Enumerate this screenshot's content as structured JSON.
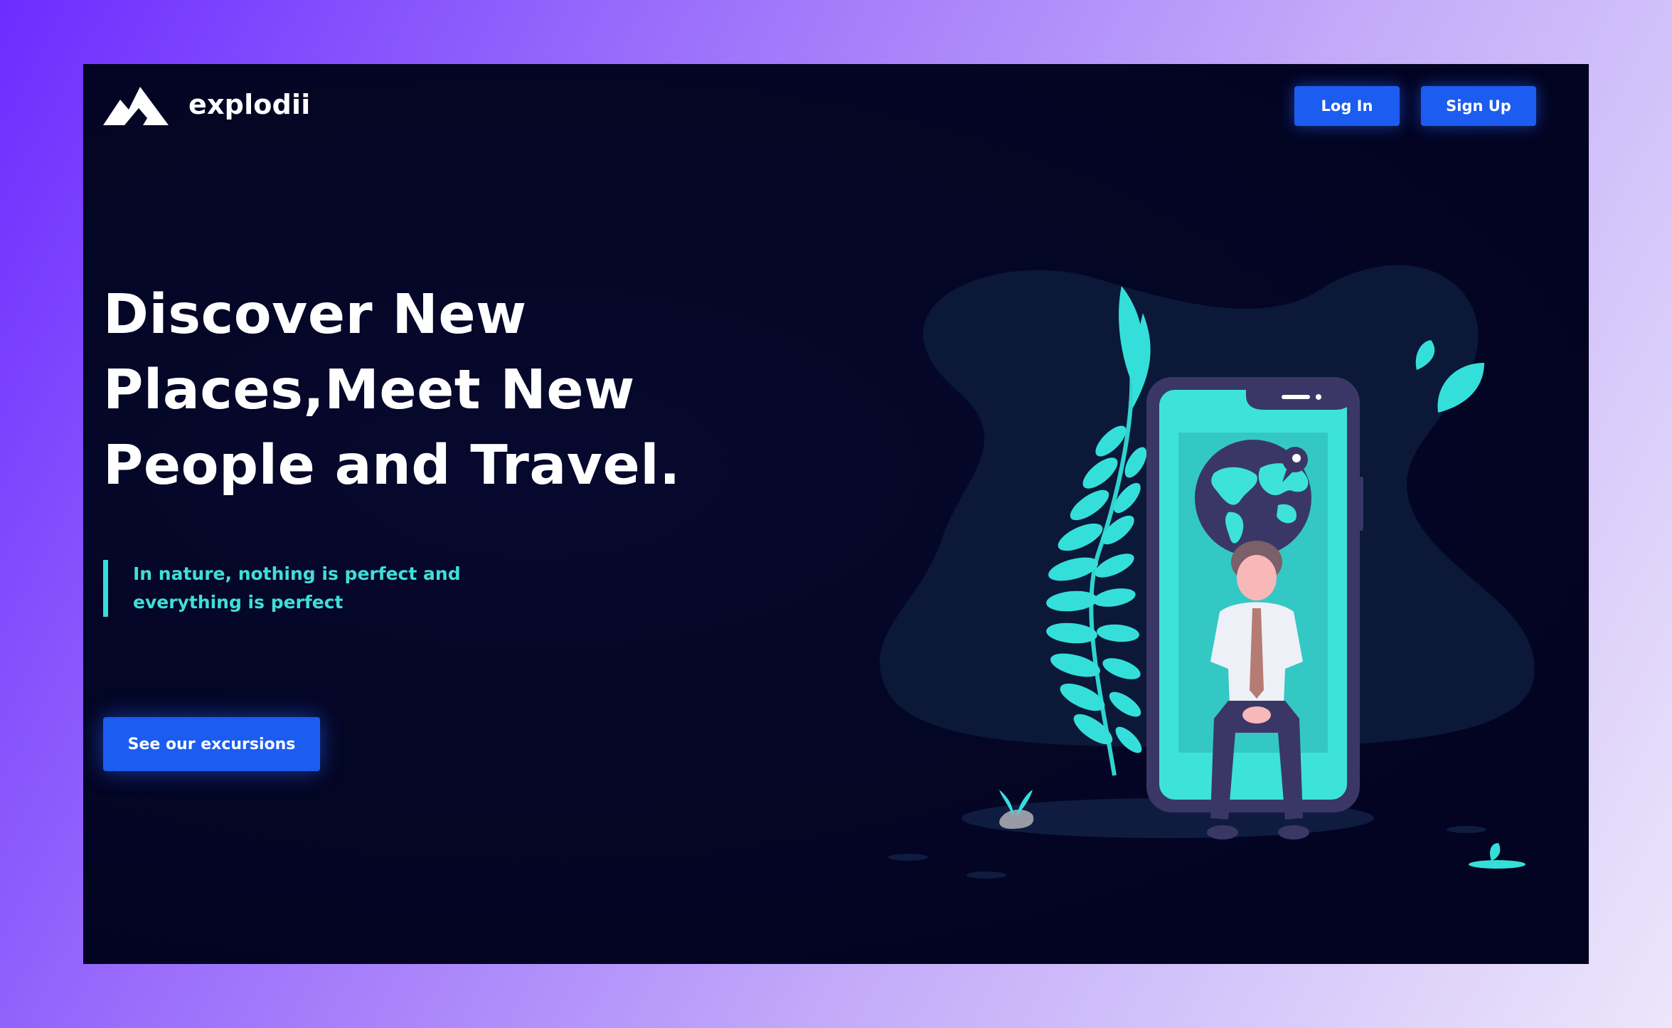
{
  "brand": {
    "name": "explodii",
    "logo_icon": "mountain-logo-icon"
  },
  "nav": {
    "login_label": "Log In",
    "signup_label": "Sign Up"
  },
  "hero": {
    "title_lines": [
      "Discover New",
      "Places,Meet New",
      "People and Travel."
    ],
    "quote": "In nature, nothing is perfect and everything is perfect",
    "cta_label": "See our excursions"
  },
  "illustration": {
    "icon": "person-sitting-in-phone-with-globe-illustration"
  },
  "colors": {
    "page_background_start": "#6c2cff",
    "page_background_end": "#ece6fb",
    "card_background": "#040625",
    "accent_blue": "#1c5cf0",
    "accent_teal": "#34dfd9",
    "blob": "#0b1838"
  }
}
